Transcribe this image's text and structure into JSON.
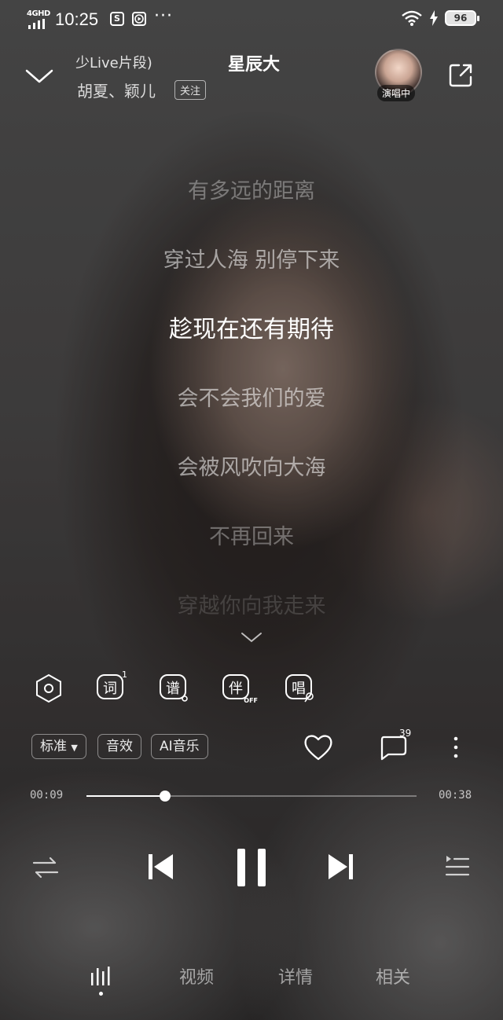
{
  "status": {
    "network": "4GHD",
    "time": "10:25",
    "battery": "96",
    "app_icon_s": "S",
    "dots": "···"
  },
  "header": {
    "song_subtitle": "少Live片段)",
    "title": "星辰大",
    "singer": "胡夏、颖儿",
    "follow_label": "关注",
    "singing_badge": "演唱中"
  },
  "lyrics": [
    "有多远的距离",
    "穿过人海 别停下来",
    "趁现在还有期待",
    "会不会我们的爱",
    "会被风吹向大海",
    "不再回来",
    "穿越你向我走来"
  ],
  "active_lyric_index": 2,
  "tools": {
    "lyrics_char": "词",
    "lyrics_count": "1",
    "score_char": "谱",
    "accompany_char": "伴",
    "accompany_state": "OFF",
    "sing_char": "唱"
  },
  "quality": {
    "standard_label": "标准",
    "effects_label": "音效",
    "ai_music_label": "AI音乐",
    "comment_count": "39"
  },
  "progress": {
    "current": "00:09",
    "total": "00:38",
    "fraction": 0.237
  },
  "tabs": [
    "视频",
    "详情",
    "相关"
  ],
  "colors": {
    "accent": "#ffffff",
    "muted_text": "#bbbbbb"
  },
  "icons": {
    "collapse": "chevron-down-icon",
    "share": "share-icon",
    "settings": "hexagon-icon",
    "favorite": "heart-icon",
    "comments": "comment-icon",
    "more": "more-vertical-icon",
    "repeat": "repeat-icon",
    "previous": "skip-previous-icon",
    "pause": "pause-icon",
    "next": "skip-next-icon",
    "playlist": "playlist-icon",
    "player_tab": "equalizer-icon"
  }
}
